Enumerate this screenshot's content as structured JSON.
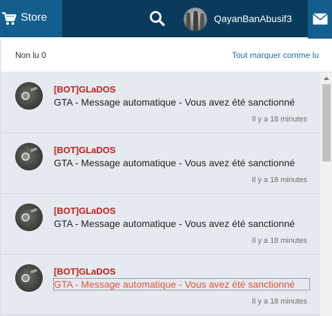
{
  "topbar": {
    "store_label": "Store",
    "username": "QayanBanAbusif3",
    "colors": {
      "bar": "#093b5c",
      "active_tab": "#135e8e"
    }
  },
  "notifications": {
    "unread_label": "Non lu 0",
    "mark_all_label": "Tout marquer comme lu",
    "items": [
      {
        "sender": "[BOT]GLaDOS",
        "subject": "GTA - Message automatique - Vous avez été sanctionné",
        "time": "Il y a 18 minutes"
      },
      {
        "sender": "[BOT]GLaDOS",
        "subject": "GTA - Message automatique - Vous avez été sanctionné",
        "time": "Il y a 18 minutes"
      },
      {
        "sender": "[BOT]GLaDOS",
        "subject": "GTA - Message automatique - Vous avez été sanctionné",
        "time": "Il y a 18 minutes"
      },
      {
        "sender": "[BOT]GLaDOS",
        "subject": "GTA - Message automatique - Vous avez été sanctionné",
        "time": "Il y a 18 minutes"
      }
    ],
    "colors": {
      "sender": "#c81d1d",
      "link": "#1d6ea6",
      "hover_subject": "#e0543a"
    }
  },
  "icons": {
    "store": "cart-icon",
    "search": "search-icon",
    "messages": "mail-icon"
  }
}
